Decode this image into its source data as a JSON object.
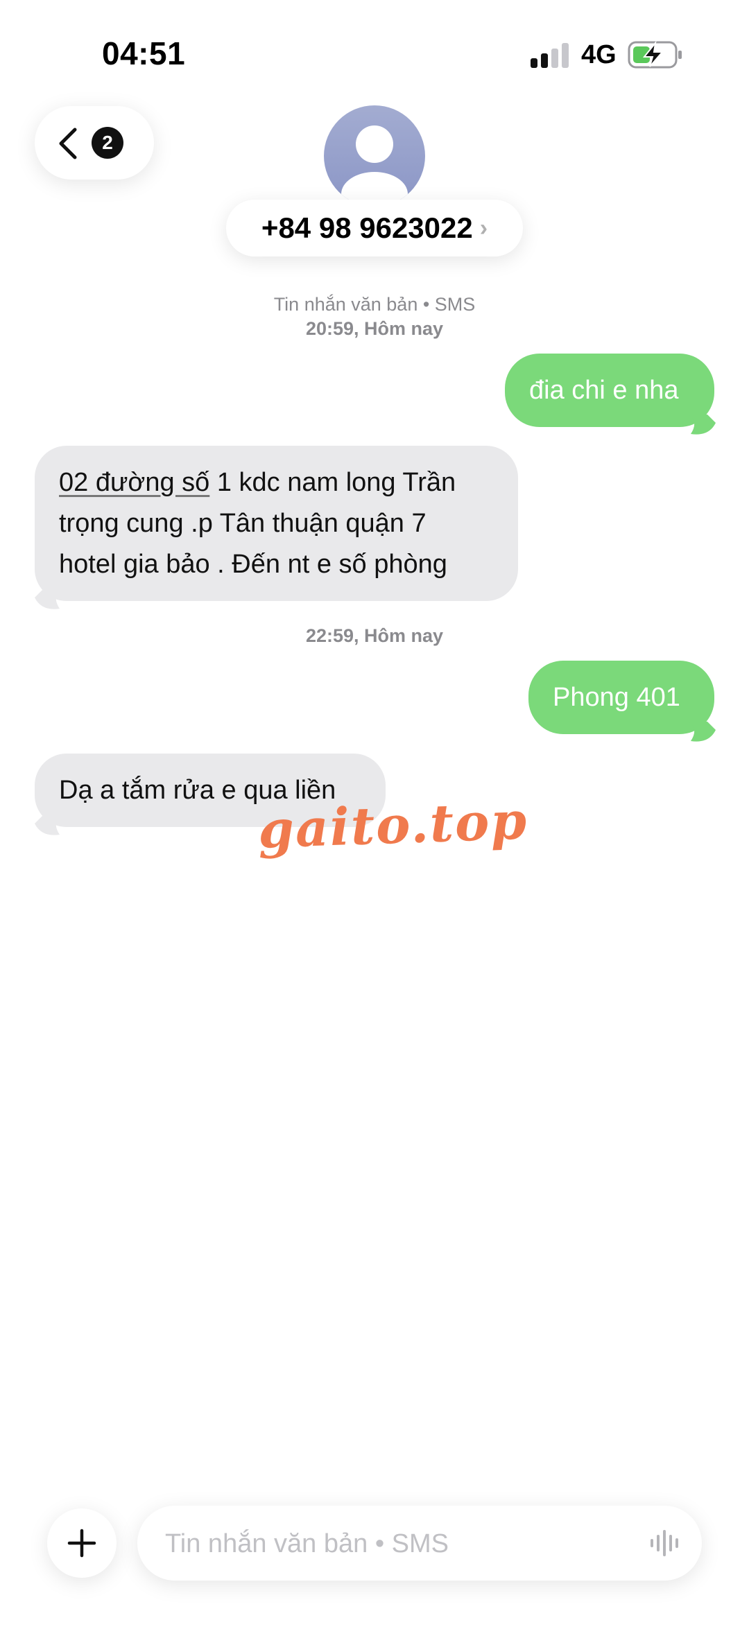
{
  "status_bar": {
    "time": "04:51",
    "network": "4G"
  },
  "header": {
    "back_badge_count": "2",
    "contact": "+84 98 9623022"
  },
  "conversation": [
    {
      "type": "meta",
      "line1": "Tin nhắn văn bản • SMS",
      "time": "20:59,",
      "day": "Hôm nay"
    },
    {
      "type": "outgoing",
      "text": "đia chi e nha"
    },
    {
      "type": "incoming",
      "text_link": "02 đường số",
      "text_rest": " 1 kdc nam long Trần\ntrọng cung .p Tân thuận quận 7\nhotel gia bảo . Đến nt e số phòng"
    },
    {
      "type": "meta",
      "time": "22:59,",
      "day": "Hôm nay"
    },
    {
      "type": "outgoing",
      "text": "Phong 401"
    },
    {
      "type": "incoming",
      "text": "Dạ a tắm rửa e qua liền"
    }
  ],
  "watermark": "gaito.top",
  "composer": {
    "placeholder": "Tin nhắn văn bản • SMS"
  },
  "colors": {
    "outgoing_bubble": "#7bd97a",
    "incoming_bubble": "#e9e9eb",
    "meta_text": "#8a8a8e",
    "watermark": "#f07a4d"
  }
}
